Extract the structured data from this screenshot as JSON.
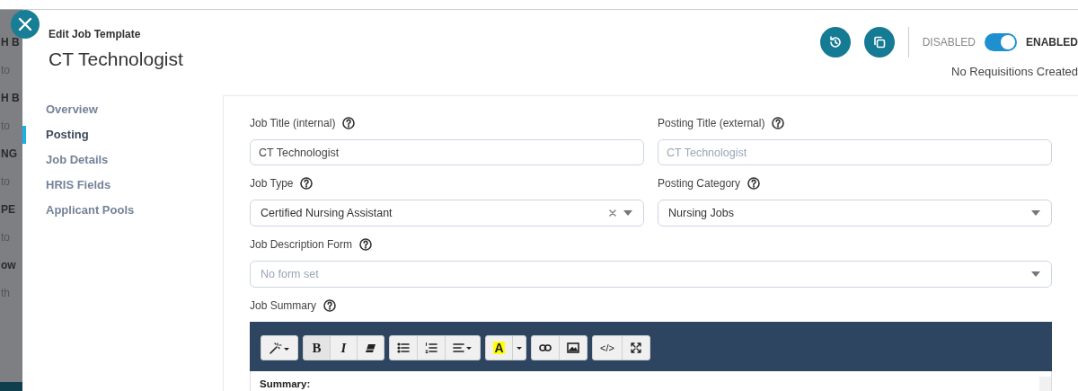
{
  "backdrop": {
    "fragments": [
      "H B",
      "to",
      "H B",
      "to",
      "NG",
      "to",
      "PE",
      "to",
      "ow",
      "th"
    ]
  },
  "header": {
    "subtitle": "Edit Job Template",
    "title": "CT Technologist"
  },
  "actions": [
    {
      "kind": "history"
    },
    {
      "kind": "copy"
    }
  ],
  "status_toggle": {
    "off_label": "DISABLED",
    "on_label": "ENABLED",
    "on": true
  },
  "requisitions": "No Requisitions Created",
  "nav": [
    {
      "label": "Overview",
      "selected": false
    },
    {
      "label": "Posting",
      "selected": true
    },
    {
      "label": "Job Details",
      "selected": false
    },
    {
      "label": "HRIS Fields",
      "selected": false
    },
    {
      "label": "Applicant Pools",
      "selected": false
    }
  ],
  "field_rows": [
    [
      {
        "label": "Job Title (internal)",
        "kind": "text",
        "value": "CT Technologist"
      },
      {
        "label": "Posting Title (external)",
        "kind": "text",
        "placeholder": "CT Technologist"
      }
    ],
    [
      {
        "label": "Job Type",
        "kind": "select",
        "value": "Certified Nursing Assistant",
        "clearable": true
      },
      {
        "label": "Posting Category",
        "kind": "select",
        "value": "Nursing Jobs",
        "clearable": false
      }
    ],
    [
      {
        "label": "Job Description Form",
        "kind": "select",
        "placeholder": "No form set",
        "clearable": false
      }
    ]
  ],
  "job_summary": {
    "label": "Job Summary",
    "toolbar": [
      [
        {
          "kind": "magic"
        }
      ],
      [
        {
          "kind": "bold",
          "label": "B"
        },
        {
          "kind": "italic",
          "label": "I"
        },
        {
          "kind": "eraser"
        }
      ],
      [
        {
          "kind": "bullets"
        },
        {
          "kind": "numbers"
        },
        {
          "kind": "align"
        }
      ],
      [
        {
          "kind": "highlight",
          "label": "A"
        },
        {
          "kind": "caret"
        }
      ],
      [
        {
          "kind": "link"
        },
        {
          "kind": "image"
        }
      ],
      [
        {
          "kind": "code",
          "label": "</>"
        },
        {
          "kind": "fullscreen"
        }
      ]
    ],
    "body": "Summary:"
  }
}
